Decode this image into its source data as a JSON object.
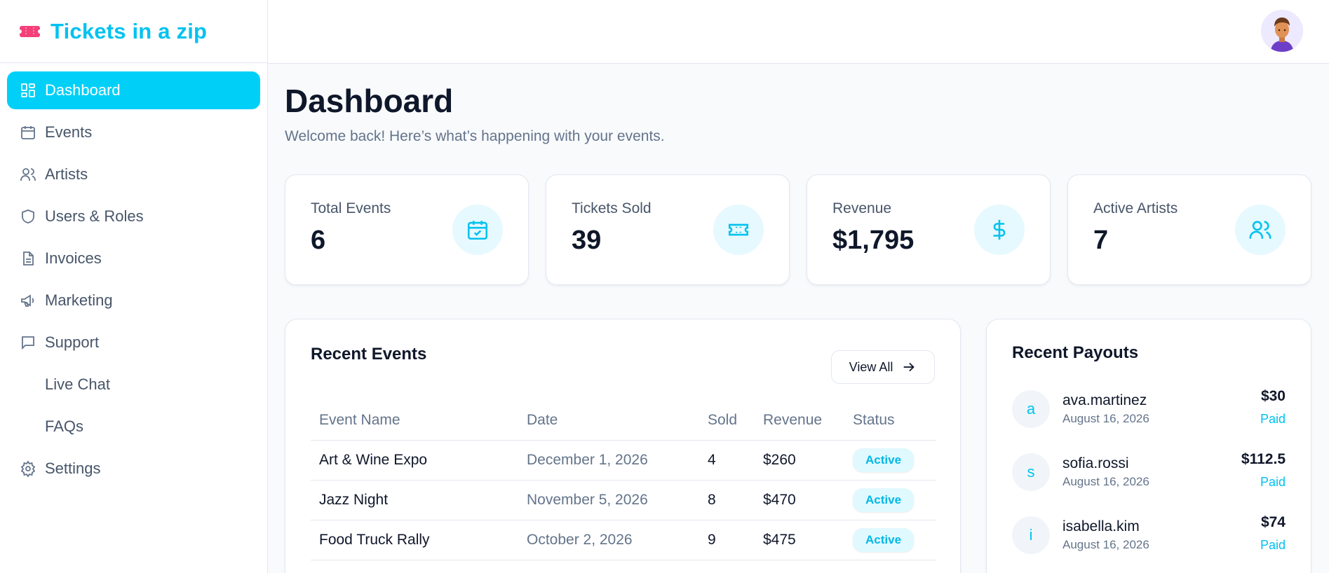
{
  "brand": {
    "name": "Tickets in a zip",
    "accent": "#00c2f0"
  },
  "sidebar": {
    "items": [
      {
        "label": "Dashboard",
        "icon": "dashboard-icon",
        "active": true
      },
      {
        "label": "Events",
        "icon": "calendar-icon"
      },
      {
        "label": "Artists",
        "icon": "users-icon"
      },
      {
        "label": "Users & Roles",
        "icon": "shield-icon"
      },
      {
        "label": "Invoices",
        "icon": "document-icon"
      },
      {
        "label": "Marketing",
        "icon": "megaphone-icon"
      },
      {
        "label": "Support",
        "icon": "chat-icon"
      },
      {
        "label": "Live Chat",
        "sub": true
      },
      {
        "label": "FAQs",
        "sub": true
      },
      {
        "label": "Settings",
        "icon": "gear-icon"
      }
    ]
  },
  "header": {
    "title": "Dashboard",
    "subtitle": "Welcome back! Here’s what’s happening with your events."
  },
  "stats": [
    {
      "label": "Total Events",
      "value": "6",
      "icon": "calendar-check-icon"
    },
    {
      "label": "Tickets Sold",
      "value": "39",
      "icon": "ticket-icon"
    },
    {
      "label": "Revenue",
      "value": "$1,795",
      "icon": "dollar-icon"
    },
    {
      "label": "Active Artists",
      "value": "7",
      "icon": "users-icon"
    }
  ],
  "recent_events": {
    "title": "Recent Events",
    "view_all_label": "View All",
    "columns": [
      "Event Name",
      "Date",
      "Sold",
      "Revenue",
      "Status"
    ],
    "rows": [
      {
        "name": "Art & Wine Expo",
        "date": "December 1, 2026",
        "sold": "4",
        "revenue": "$260",
        "status": "Active"
      },
      {
        "name": "Jazz Night",
        "date": "November 5, 2026",
        "sold": "8",
        "revenue": "$470",
        "status": "Active"
      },
      {
        "name": "Food Truck Rally",
        "date": "October 2, 2026",
        "sold": "9",
        "revenue": "$475",
        "status": "Active"
      }
    ]
  },
  "recent_payouts": {
    "title": "Recent Payouts",
    "items": [
      {
        "initial": "a",
        "name": "ava.martinez",
        "date": "August 16, 2026",
        "amount": "$30",
        "status": "Paid"
      },
      {
        "initial": "s",
        "name": "sofia.rossi",
        "date": "August 16, 2026",
        "amount": "$112.5",
        "status": "Paid"
      },
      {
        "initial": "i",
        "name": "isabella.kim",
        "date": "August 16, 2026",
        "amount": "$74",
        "status": "Paid"
      }
    ]
  }
}
